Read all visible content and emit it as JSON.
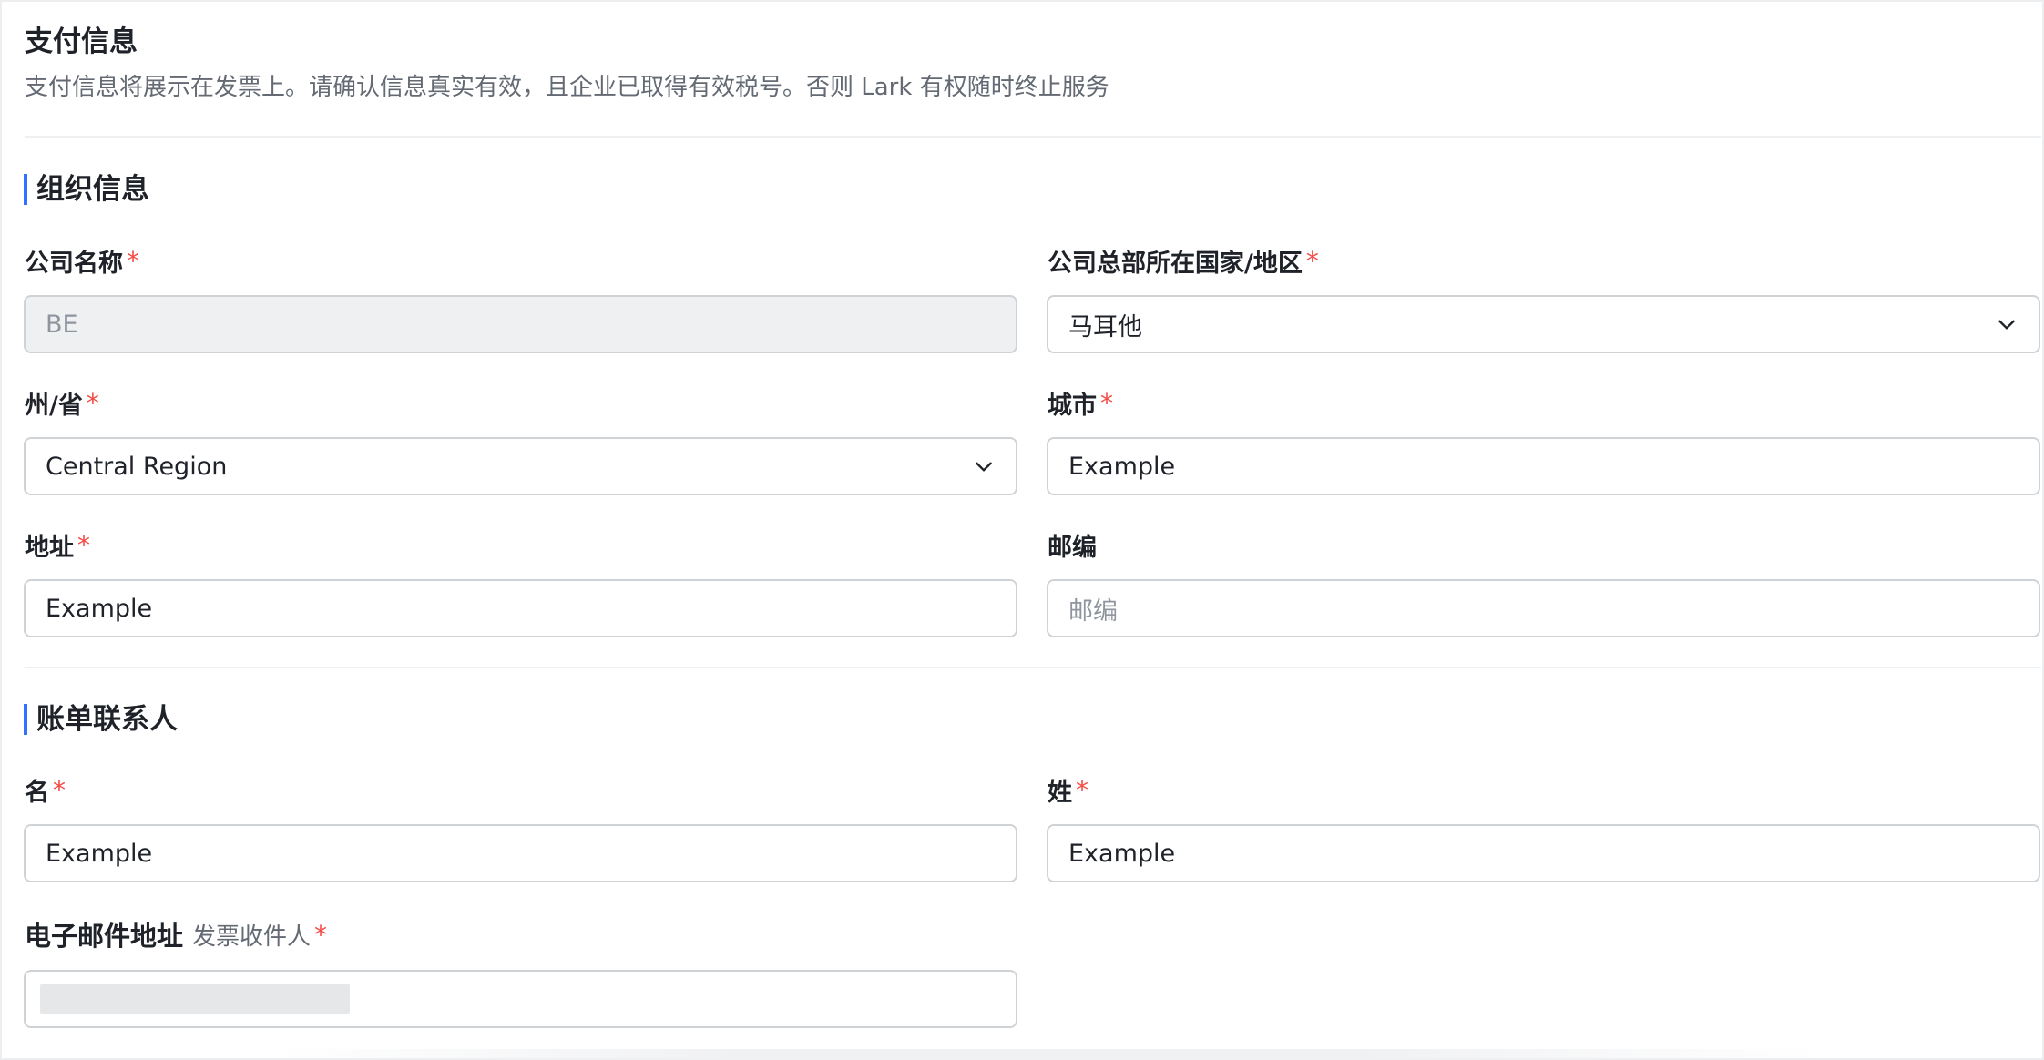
{
  "header": {
    "title": "支付信息",
    "description": "支付信息将展示在发票上。请确认信息真实有效，且企业已取得有效税号。否则 Lark 有权随时终止服务"
  },
  "org_section": {
    "title": "组织信息",
    "company_name": {
      "label": "公司名称",
      "required_mark": "*",
      "value": "BE",
      "disabled": true
    },
    "hq_country": {
      "label": "公司总部所在国家/地区",
      "required_mark": "*",
      "value": "马耳他",
      "type": "select"
    },
    "state": {
      "label": "州/省",
      "required_mark": "*",
      "value": "Central Region",
      "type": "select"
    },
    "city": {
      "label": "城市",
      "required_mark": "*",
      "value": "Example"
    },
    "address": {
      "label": "地址",
      "required_mark": "*",
      "value": "Example"
    },
    "postcode": {
      "label": "邮编",
      "value": "",
      "placeholder": "邮编"
    }
  },
  "billing_section": {
    "title": "账单联系人",
    "first_name": {
      "label": "名",
      "required_mark": "*",
      "value": "Example"
    },
    "last_name": {
      "label": "姓",
      "required_mark": "*",
      "value": "Example"
    },
    "email": {
      "label": "电子邮件地址",
      "hint": "发票收件人",
      "required_mark": "*",
      "value": ""
    }
  },
  "icons": {
    "select_arrow": "chevron-down-icon"
  },
  "colors": {
    "accent": "#3370ff",
    "required": "#f54a45",
    "text_primary": "#1f2329",
    "text_secondary": "#646a73",
    "border": "#d0d3d6",
    "disabled_bg": "#eff0f1"
  }
}
